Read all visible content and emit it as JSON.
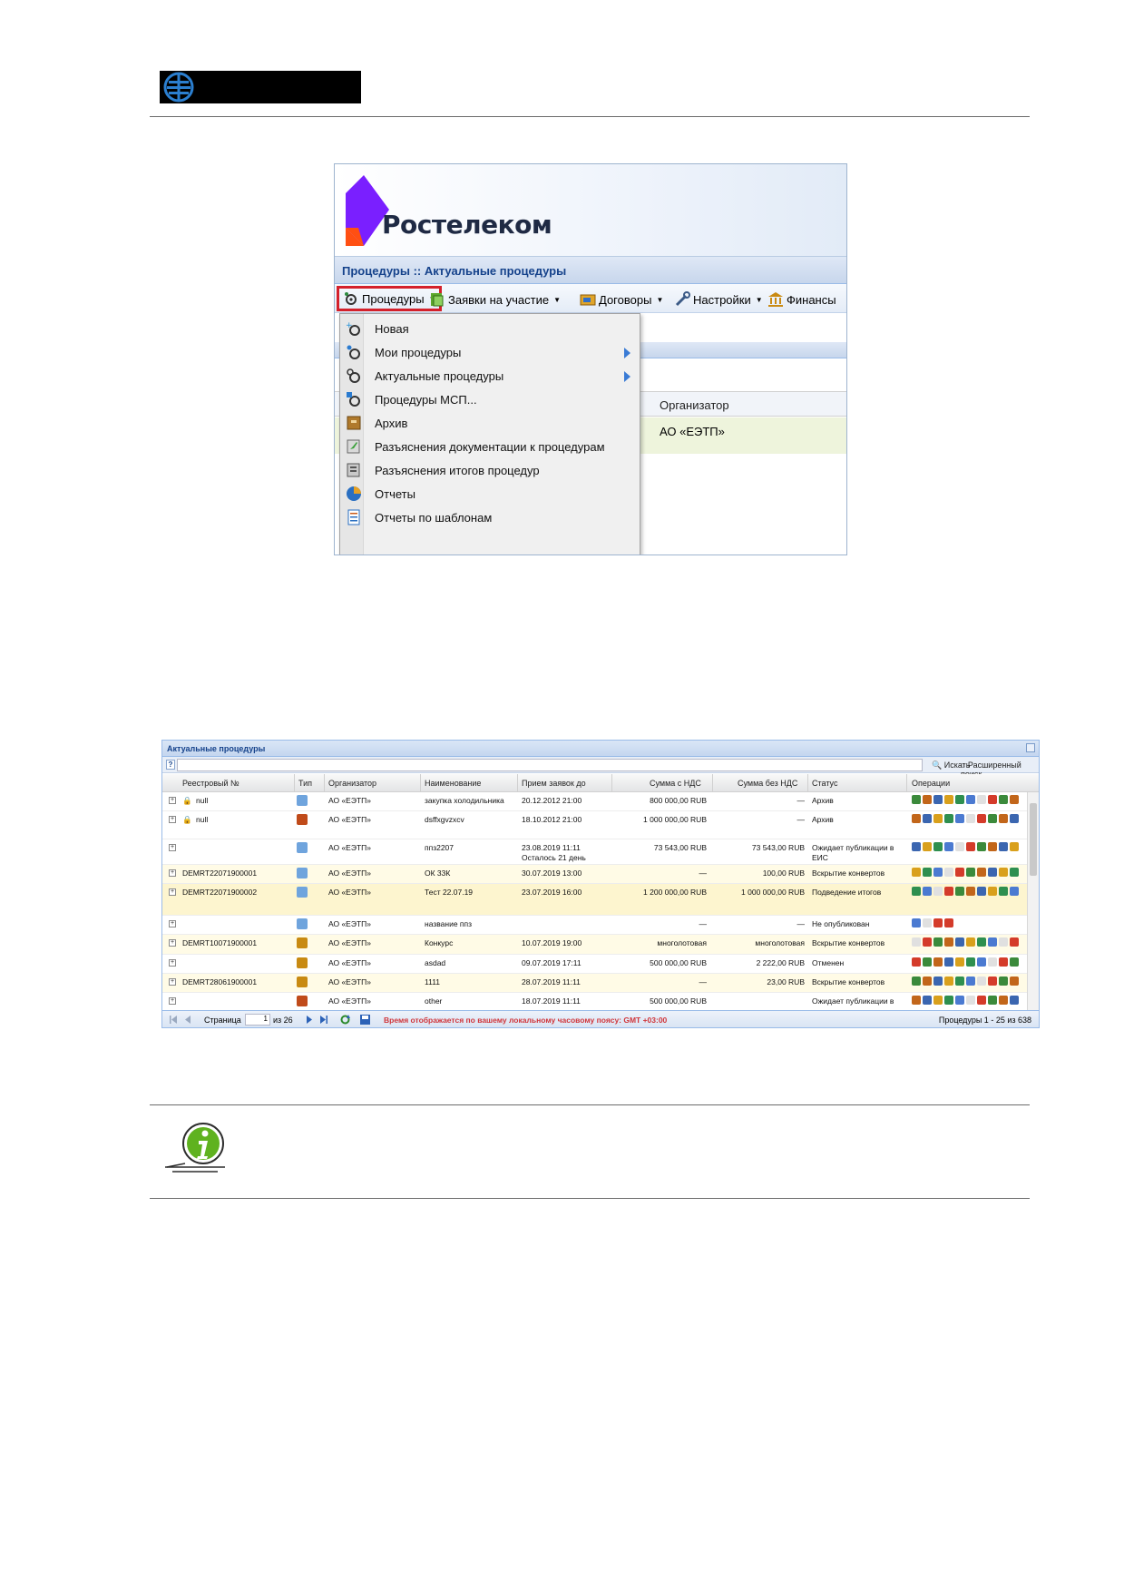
{
  "shot1": {
    "brand": "Ростелеком",
    "page_title": "Процедуры :: Актуальные процедуры",
    "toolbar": [
      {
        "label": "Процедуры",
        "icon": "procedures-icon"
      },
      {
        "label": "Заявки на участие",
        "icon": "applications-icon"
      },
      {
        "label": "Договоры",
        "icon": "contracts-icon"
      },
      {
        "label": "Настройки",
        "icon": "wrench-icon"
      },
      {
        "label": "Финансы",
        "icon": "bank-icon"
      }
    ],
    "menu": [
      {
        "label": "Новая",
        "icon": "new-procedure-icon"
      },
      {
        "label": "Мои процедуры",
        "icon": "my-procedures-icon"
      },
      {
        "label": "Актуальные процедуры",
        "icon": "actual-procedures-icon"
      },
      {
        "label": "Процедуры МСП...",
        "icon": "msp-procedures-icon"
      },
      {
        "label": "Архив",
        "icon": "archive-icon"
      },
      {
        "label": "Разъяснения документации к процедурам",
        "icon": "clarification-docs-icon"
      },
      {
        "label": "Разъяснения итогов процедур",
        "icon": "clarification-results-icon"
      },
      {
        "label": "Отчеты",
        "icon": "reports-icon"
      },
      {
        "label": "Отчеты по шаблонам",
        "icon": "template-reports-icon"
      }
    ],
    "grid": {
      "column": "Организатор",
      "value": "АО «ЕЭТП»"
    }
  },
  "shot2": {
    "title": "Актуальные процедуры",
    "help": "?",
    "find_label": "Искать",
    "advanced_label": "Расширенный поиск",
    "columns": [
      "Реестровый №",
      "Тип",
      "Организатор",
      "Наименование",
      "Прием заявок до",
      "Сумма с НДС",
      "Сумма без НДС",
      "Статус",
      "Операции"
    ],
    "rows": [
      {
        "reg": "null",
        "org": "АО «ЕЭТП»",
        "name": "закупка холодильника",
        "deadline": "20.12.2012 21:00",
        "sum_vat": "800 000,00 RUB",
        "sum_novat": "—",
        "status": "Архив"
      },
      {
        "reg": "null",
        "org": "АО «ЕЭТП»",
        "name": "dsffxgvzxcv",
        "deadline": "18.10.2012 21:00",
        "sum_vat": "1 000 000,00 RUB",
        "sum_novat": "—",
        "status": "Архив"
      },
      {
        "reg": "",
        "org": "АО «ЕЭТП»",
        "name": "ппз2207",
        "deadline": "23.08.2019 11:11",
        "deadline2": "Осталось 21 день",
        "sum_vat": "73 543,00 RUB",
        "sum_novat": "73 543,00 RUB",
        "status": "Ожидает публикации в",
        "status2": "ЕИС"
      },
      {
        "reg": "DEMRT22071900001",
        "org": "АО «ЕЭТП»",
        "name": "ОК 33К",
        "deadline": "30.07.2019 13:00",
        "sum_vat": "—",
        "sum_novat": "100,00 RUB",
        "status": "Вскрытие конвертов"
      },
      {
        "reg": "DEMRT22071900002",
        "org": "АО «ЕЭТП»",
        "name": "Тест 22.07.19",
        "deadline": "23.07.2019 16:00",
        "sum_vat": "1 200 000,00 RUB",
        "sum_novat": "1 000 000,00 RUB",
        "status": "Подведение итогов"
      },
      {
        "reg": "",
        "org": "АО «ЕЭТП»",
        "name": "название ппз",
        "deadline": "",
        "sum_vat": "—",
        "sum_novat": "—",
        "status": "Не опубликован"
      },
      {
        "reg": "DEMRT10071900001",
        "org": "АО «ЕЭТП»",
        "name": "Конкурс",
        "deadline": "10.07.2019 19:00",
        "sum_vat": "многолотовая",
        "sum_novat": "многолотовая",
        "status": "Вскрытие конвертов"
      },
      {
        "reg": "",
        "org": "АО «ЕЭТП»",
        "name": "asdad",
        "deadline": "09.07.2019 17:11",
        "sum_vat": "500 000,00 RUB",
        "sum_novat": "2 222,00 RUB",
        "status": "Отменен"
      },
      {
        "reg": "DEMRT28061900001",
        "org": "АО «ЕЭТП»",
        "name": "1111",
        "deadline": "28.07.2019 11:11",
        "sum_vat": "—",
        "sum_novat": "23,00 RUB",
        "status": "Вскрытие конвертов"
      },
      {
        "reg": "",
        "org": "АО «ЕЭТП»",
        "name": "other",
        "deadline": "18.07.2019 11:11",
        "sum_vat": "500 000,00 RUB",
        "sum_novat": "",
        "status": "Ожидает публикации в"
      }
    ],
    "footer": {
      "page_label": "Страница",
      "page_value": "1",
      "of_label": "из 26",
      "tz_note": "Время отображается по вашему локальному часовому поясу: GMT +03:00",
      "summary": "Процедуры 1 - 25 из 638"
    }
  },
  "colors": {
    "rostelecom_purple": "#7a1fff",
    "rostelecom_orange": "#ff4f12",
    "ext_blue": "#15428b",
    "highlight_red": "#d4202b",
    "info_green": "#5fb21f"
  }
}
